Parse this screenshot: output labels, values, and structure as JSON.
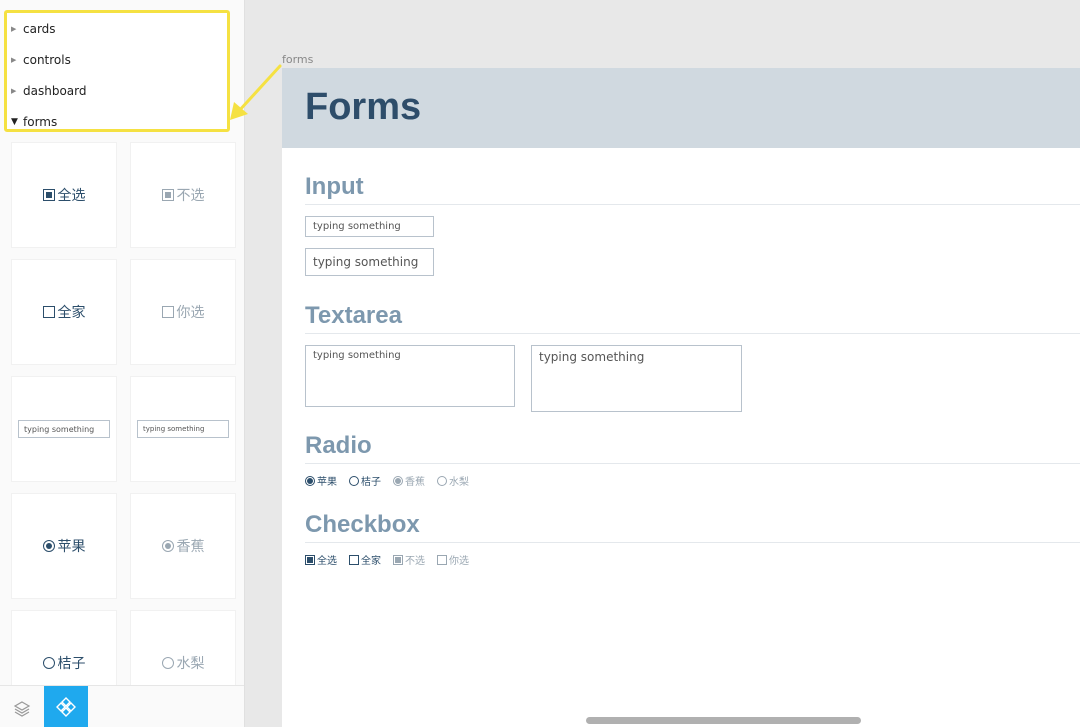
{
  "sidebar": {
    "tree": [
      {
        "label": "cards",
        "open": false
      },
      {
        "label": "controls",
        "open": false
      },
      {
        "label": "dashboard",
        "open": false
      },
      {
        "label": "forms",
        "open": true
      }
    ],
    "thumbnails": {
      "checkbox_checked": "全选",
      "checkbox_checked_disabled": "不选",
      "checkbox_unchecked": "全家",
      "checkbox_unchecked_disabled": "你选",
      "input_large": "typing something",
      "input_small": "typing something",
      "radio_checked": "苹果",
      "radio_checked_disabled": "香蕉",
      "radio_unchecked": "桔子",
      "radio_unchecked_disabled": "水梨"
    },
    "bottom_bar": {
      "layers_icon": "layers-icon",
      "components_icon": "components-icon"
    }
  },
  "canvas": {
    "artboard_label": "forms",
    "page_title": "Forms",
    "sections": {
      "input": {
        "title": "Input",
        "small_placeholder": "typing something",
        "large_placeholder": "typing something"
      },
      "textarea": {
        "title": "Textarea",
        "small_placeholder": "typing something",
        "large_placeholder": "typing something"
      },
      "radio": {
        "title": "Radio",
        "options": [
          "苹果",
          "桔子",
          "香蕉",
          "水梨"
        ]
      },
      "checkbox": {
        "title": "Checkbox",
        "options": [
          "全选",
          "全家",
          "不选",
          "你选"
        ]
      }
    }
  },
  "colors": {
    "highlight": "#f5e142",
    "accent": "#1fa9ee",
    "title": "#2e4d6a",
    "section": "#7d98ae",
    "header_bg": "#d0d9e0"
  }
}
